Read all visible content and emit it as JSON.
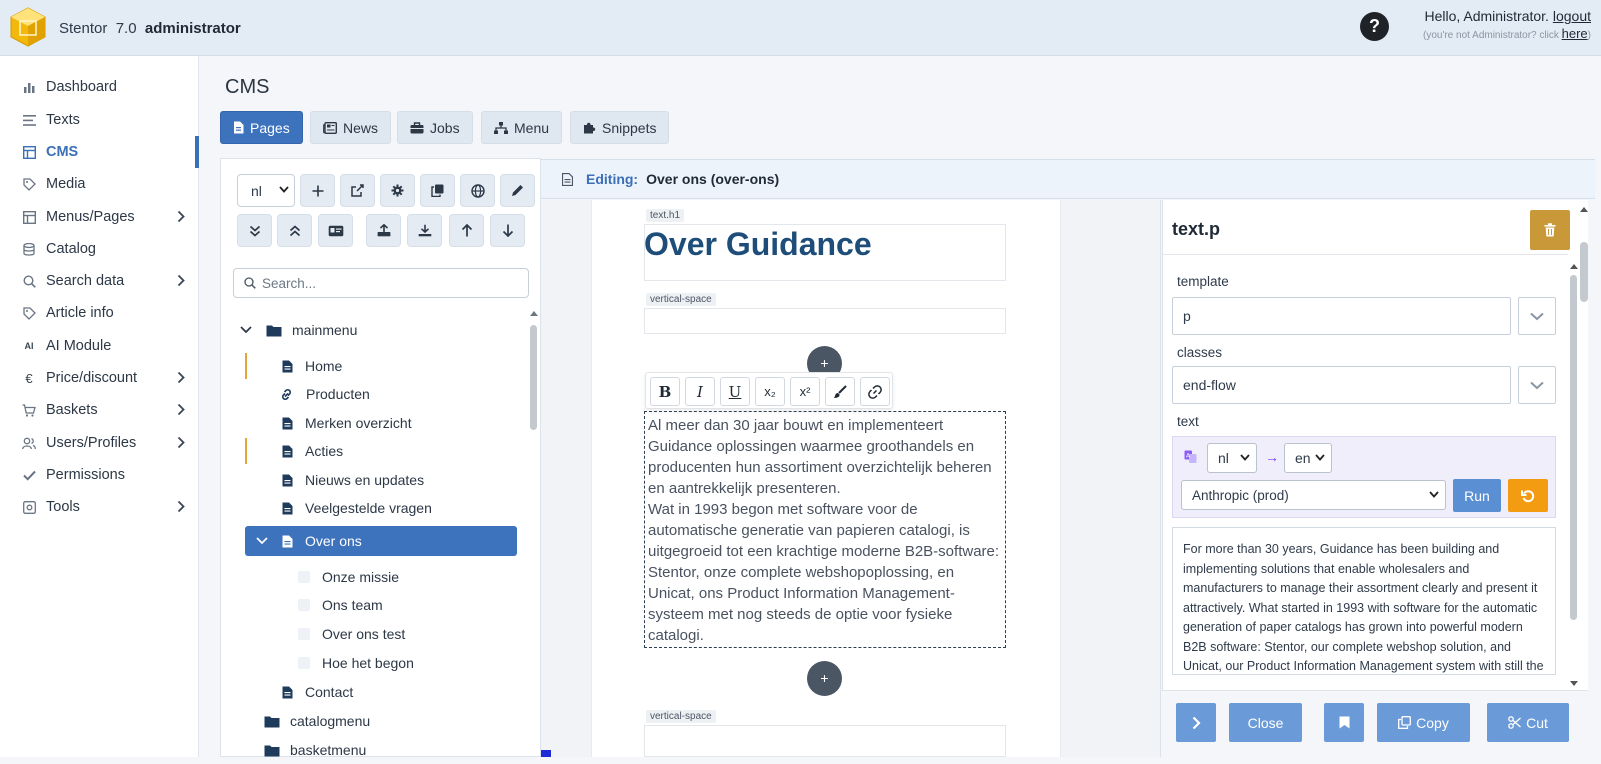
{
  "header": {
    "app_name": "Stentor",
    "version": "7.0",
    "role": "administrator",
    "greeting": "Hello, Administrator.",
    "logout": "logout",
    "not_user_text": "(you're not Administrator? click",
    "here_link": "here",
    "close_paren": ")",
    "help": "?"
  },
  "sidebar": {
    "items": [
      {
        "label": "Dashboard",
        "icon": "bar-chart-icon"
      },
      {
        "label": "Texts",
        "icon": "lines-icon"
      },
      {
        "label": "CMS",
        "icon": "layout-icon"
      },
      {
        "label": "Media",
        "icon": "tag-icon"
      },
      {
        "label": "Menus/Pages",
        "icon": "layout-icon"
      },
      {
        "label": "Catalog",
        "icon": "database-icon"
      },
      {
        "label": "Search data",
        "icon": "search-icon"
      },
      {
        "label": "Article info",
        "icon": "tag-icon"
      },
      {
        "label": "AI Module",
        "icon": "ai-icon"
      },
      {
        "label": "Price/discount",
        "icon": "euro-icon"
      },
      {
        "label": "Baskets",
        "icon": "cart-icon"
      },
      {
        "label": "Users/Profiles",
        "icon": "users-icon"
      },
      {
        "label": "Permissions",
        "icon": "check-icon"
      },
      {
        "label": "Tools",
        "icon": "tools-icon"
      }
    ],
    "ai_glyph": "AI",
    "euro_glyph": "€"
  },
  "main": {
    "title": "CMS",
    "tabs": [
      {
        "label": "Pages"
      },
      {
        "label": "News"
      },
      {
        "label": "Jobs"
      },
      {
        "label": "Menu"
      },
      {
        "label": "Snippets"
      }
    ]
  },
  "tree": {
    "language": "nl",
    "search_placeholder": "Search...",
    "root": "mainmenu",
    "items": [
      {
        "label": "Home"
      },
      {
        "label": "Producten"
      },
      {
        "label": "Merken overzicht"
      },
      {
        "label": "Acties"
      },
      {
        "label": "Nieuws en updates"
      },
      {
        "label": "Veelgestelde vragen"
      },
      {
        "label": "Over ons"
      },
      {
        "label": "Onze missie"
      },
      {
        "label": "Ons team"
      },
      {
        "label": "Over ons test"
      },
      {
        "label": "Hoe het begon"
      },
      {
        "label": "Contact"
      }
    ],
    "other_menus": [
      {
        "label": "catalogmenu"
      },
      {
        "label": "basketmenu"
      }
    ]
  },
  "editor": {
    "editing_label": "Editing:",
    "page": "Over ons (over-ons)",
    "blocks": {
      "h1_label": "text.h1",
      "h1_text": "Over Guidance",
      "vspace_label": "vertical-space",
      "vspace_label2": "vertical-space"
    },
    "plus": "+",
    "format_buttons": {
      "bold": "B",
      "italic": "I",
      "underline": "U",
      "sub": "x₂",
      "sup": "x²"
    },
    "paragraph": "Al meer dan 30 jaar bouwt en implementeert Guidance oplossingen waarmee groothandels en producenten hun assortiment overzichtelijk beheren en aantrekkelijk presenteren.\nWat in 1993 begon met software voor de automatische generatie van papieren catalogi, is uitgegroeid tot een krachtige moderne B2B-software: Stentor, onze complete webshopoplossing, en Unicat, ons Product Information Management-systeem met nog steeds de optie voor fysieke catalogi."
  },
  "properties": {
    "title": "text.p",
    "template_label": "template",
    "template_value": "p",
    "classes_label": "classes",
    "classes_value": "end-flow",
    "text_label": "text",
    "from_lang": "nl",
    "arrow": "→",
    "to_lang": "en",
    "model": "Anthropic (prod)",
    "run": "Run",
    "translation": "For more than 30 years, Guidance has been building and implementing solutions that enable wholesalers and manufacturers to manage their assortment clearly and present it attractively. What started in 1993 with software for the automatic generation of paper catalogs has grown into powerful modern B2B software: Stentor, our complete webshop solution, and Unicat, our Product Information Management system with still the option for physical catalogs.",
    "buttons": {
      "close": "Close",
      "copy": "Copy",
      "cut": "Cut"
    }
  },
  "colors": {
    "accent": "#3d72bd",
    "warning": "#c99838",
    "tree_marker": "#e7a43b",
    "reset": "#f39c12"
  }
}
